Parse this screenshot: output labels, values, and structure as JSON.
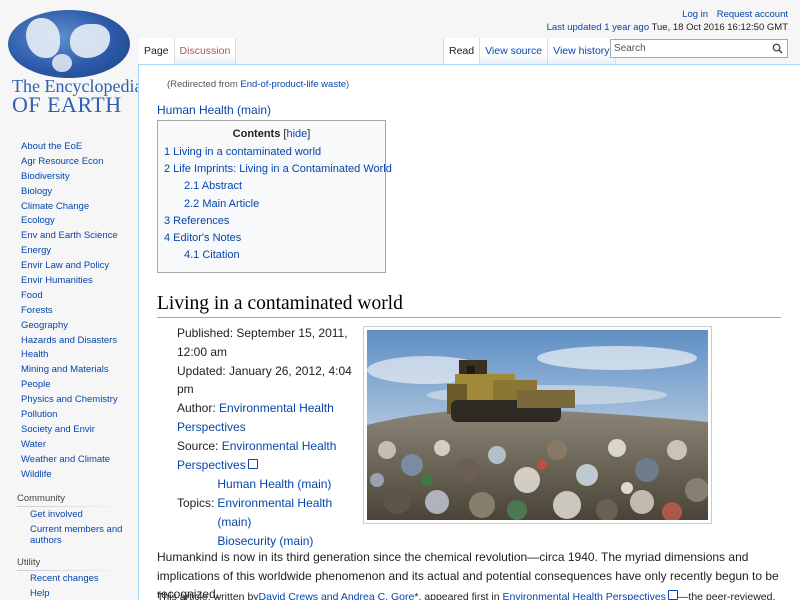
{
  "logo": {
    "line1": "The Encyclopedia",
    "line2": "OF EARTH"
  },
  "sidebar": {
    "nav": [
      "About the EoE",
      "Agr Resource Econ",
      "Biodiversity",
      "Biology",
      "Climate Change",
      "Ecology",
      "Env and Earth Science",
      "Energy",
      "Envir Law and Policy",
      "Envir Humanities",
      "Food",
      "Forests",
      "Geography",
      "Hazards and Disasters",
      "Health",
      "Mining and Materials",
      "People",
      "Physics and Chemistry",
      "Pollution",
      "Society and Envir",
      "Water",
      "Weather and Climate",
      "Wildlife"
    ],
    "community": {
      "heading": "Community",
      "items": [
        "Get involved",
        "Current members and authors"
      ]
    },
    "utility": {
      "heading": "Utility",
      "items": [
        "Recent changes",
        "Help"
      ]
    }
  },
  "personal": {
    "login": "Log in",
    "request": "Request account",
    "last_updated_link": "Last updated 1 year ago",
    "last_updated_time": "Tue, 18 Oct 2016 16:12:50 GMT"
  },
  "tabs": {
    "page": "Page",
    "discussion": "Discussion",
    "read": "Read",
    "view_source": "View source",
    "view_history": "View history"
  },
  "search": {
    "placeholder": "Search"
  },
  "content": {
    "redirect_prefix": "(Redirected from ",
    "redirect_link": "End-of-product-life waste",
    "redirect_suffix": ")",
    "category_link": "Human Health (main)",
    "toc": {
      "title": "Contents",
      "hide": "hide",
      "items": [
        "1 Living in a contaminated world",
        "2 Life Imprints: Living in a Contaminated World",
        "2.1 Abstract",
        "2.2 Main Article",
        "3 References",
        "4 Editor's Notes",
        "4.1 Citation"
      ]
    },
    "heading": "Living in a contaminated world",
    "infobox": {
      "published": "Published: September 15, 2011, 12:00 am",
      "updated": "Updated: January 26, 2012, 4:04 pm",
      "author_label": "Author: ",
      "author_link": "Environmental Health Perspectives",
      "source_label": "Source: ",
      "source_link": "Environmental Health Perspectives",
      "topics_label": "Topics:",
      "topics": [
        "Human Health (main)",
        "Environmental Health (main)",
        "Biosecurity (main)"
      ]
    },
    "para1": "Humankind is now in its third generation since the chemical revolution—circa 1940. The myriad dimensions and implications of this worldwide phenomenon and its actual and potential consequences have only recently begun to be recognized.",
    "para2": {
      "prefix": "This article, written by",
      "authors": "David Crews and Andrea C. Gore",
      "mid": "*, appeared first in ",
      "journal": "Environmental Health Perspectives",
      "suffix": "—the peer-reviewed,"
    }
  }
}
